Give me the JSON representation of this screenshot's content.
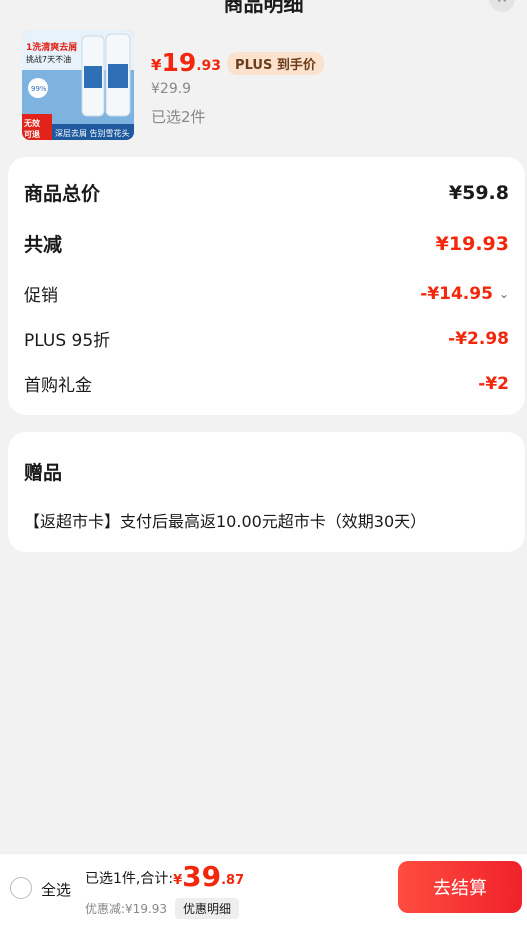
{
  "header": {
    "title": "商品明细",
    "close_icon": "close-icon"
  },
  "product": {
    "image_alt": "洗发水商品图",
    "image_texts": [
      "1洗清爽去屑",
      "挑战7天不油",
      "无效可退",
      "深层去屑 告别雪花头"
    ],
    "price_currency": "¥",
    "price_int": "19",
    "price_dec": ".93",
    "plus_badge": "PLUS 到手价",
    "original_price": "¥29.9",
    "selected_count": "已选2件"
  },
  "summary": {
    "total_label": "商品总价",
    "total_value": "¥59.8",
    "reduce_label": "共减",
    "reduce_value": "¥19.93",
    "promo_label": "促销",
    "promo_value": "-¥14.95",
    "plus_label": "PLUS 95折",
    "plus_value": "-¥2.98",
    "first_label": "首购礼金",
    "first_value": "-¥2"
  },
  "gift": {
    "title": "赠品",
    "description": "【返超市卡】支付后最高返10.00元超市卡（效期30天）"
  },
  "bottom": {
    "select_all": "全选",
    "total_prefix": "已选1件,合计:",
    "total_currency": "¥",
    "total_int": "39",
    "total_dec": ".87",
    "discount_text": "优惠减:¥19.93",
    "discount_detail_btn": "优惠明细",
    "checkout_btn": "去结算"
  },
  "colors": {
    "accent": "#f2270c",
    "plus_bg": "#fbe2cf",
    "background": "#f2f2f2"
  }
}
